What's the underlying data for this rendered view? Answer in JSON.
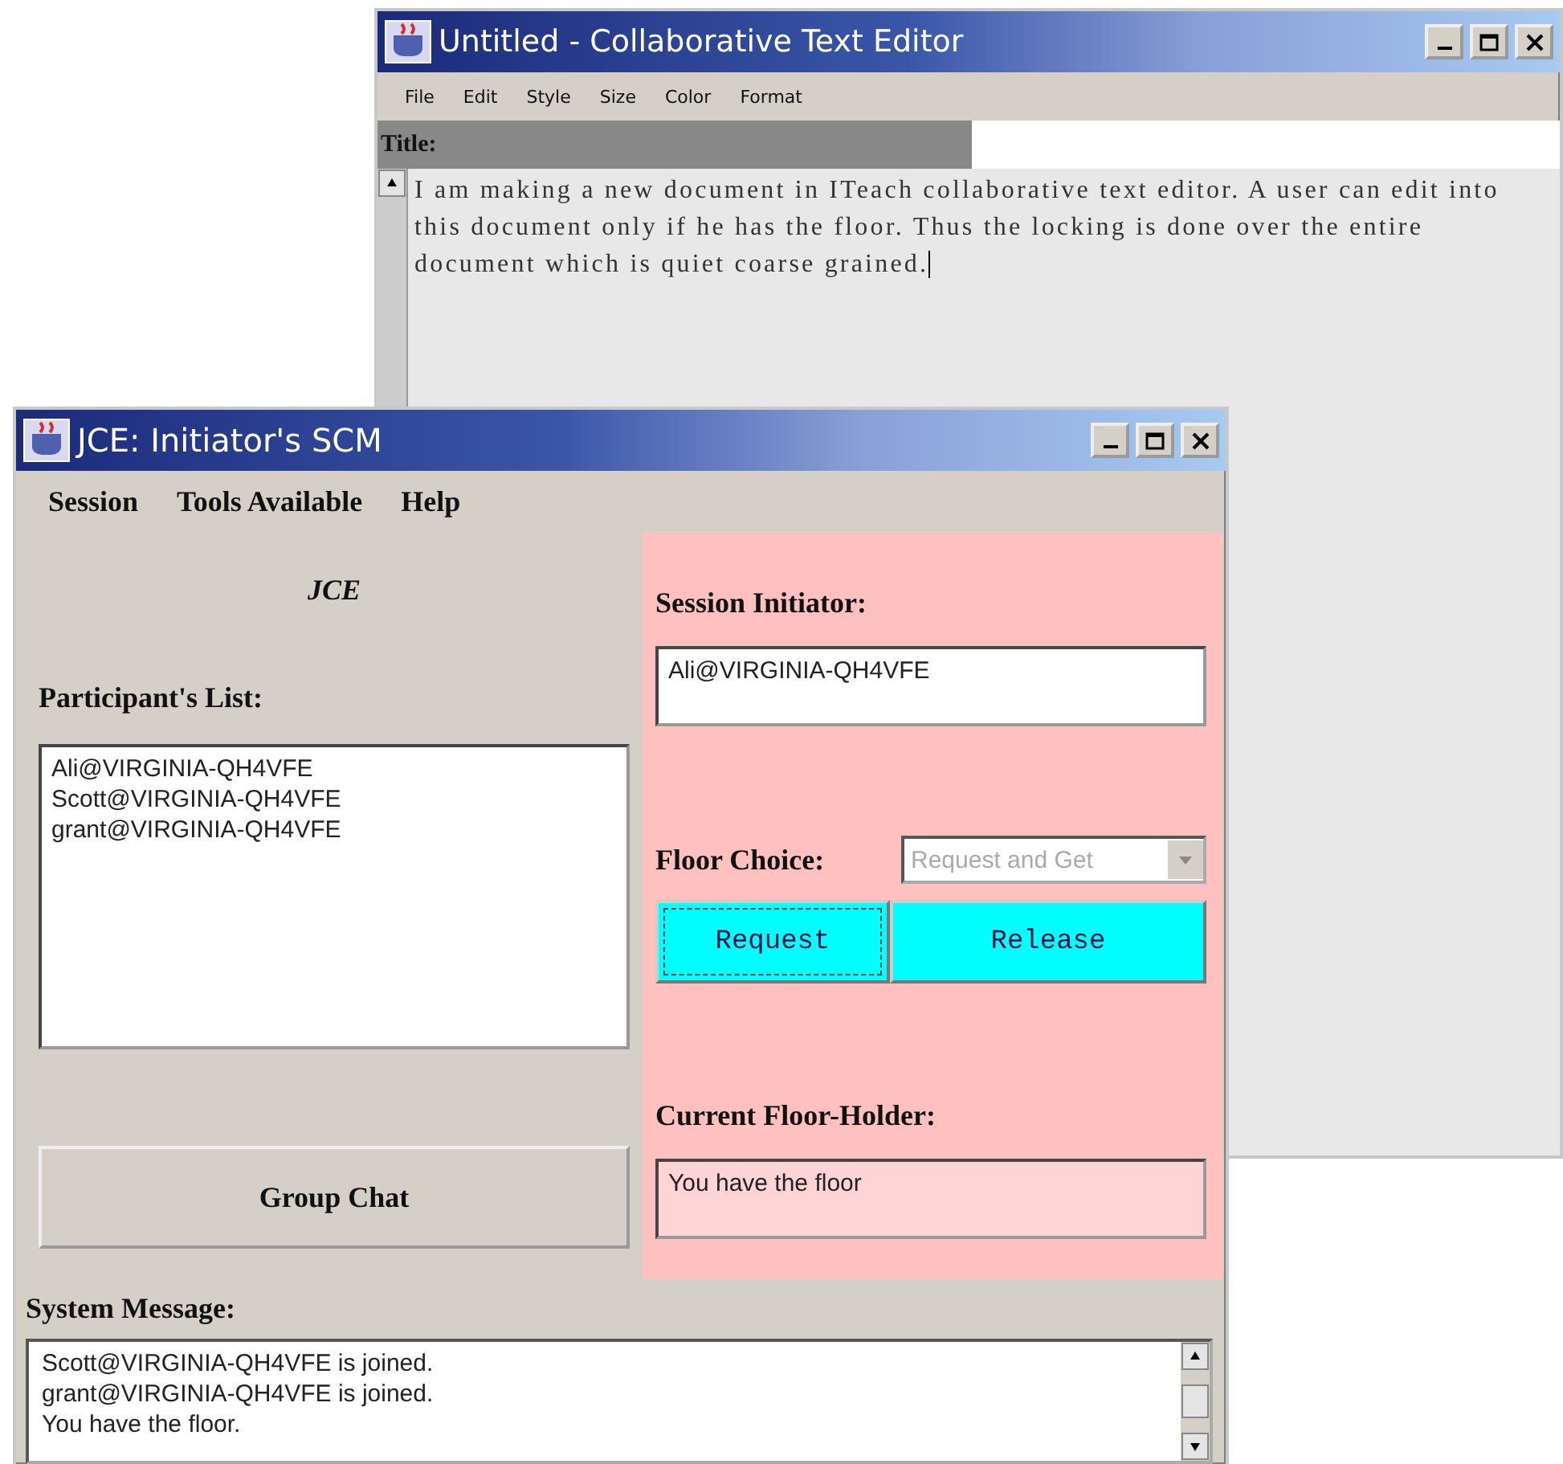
{
  "editor_window": {
    "title": "Untitled - Collaborative Text Editor",
    "menu": [
      "File",
      "Edit",
      "Style",
      "Size",
      "Color",
      "Format"
    ],
    "title_label": "Title:",
    "document_text": "I am making a new document in ITeach collaborative text editor. A user can edit into this document only if he has the floor. Thus the locking is done over the entire document which is quiet coarse grained."
  },
  "scm_window": {
    "title": "JCE: Initiator's SCM",
    "menu": [
      "Session",
      "Tools Available",
      "Help"
    ],
    "left_panel": {
      "heading": "JCE",
      "participants_label": "Participant's List:",
      "participants": [
        "Ali@VIRGINIA-QH4VFE",
        "Scott@VIRGINIA-QH4VFE",
        "grant@VIRGINIA-QH4VFE"
      ],
      "group_chat_button": "Group Chat"
    },
    "right_panel": {
      "initiator_label": "Session Initiator:",
      "initiator_value": "Ali@VIRGINIA-QH4VFE",
      "floor_choice_label": "Floor Choice:",
      "floor_choice": {
        "value": "Request and Get",
        "disabled": true
      },
      "buttons": [
        {
          "label": "Request",
          "focused": true
        },
        {
          "label": "Release",
          "focused": false
        }
      ],
      "floor_holder_label": "Current Floor-Holder:",
      "floor_holder_value": "You have the floor"
    },
    "system_message_label": "System Message:",
    "system_messages": [
      "Scott@VIRGINIA-QH4VFE is joined.",
      "grant@VIRGINIA-QH4VFE is joined.",
      "You have the floor."
    ]
  }
}
